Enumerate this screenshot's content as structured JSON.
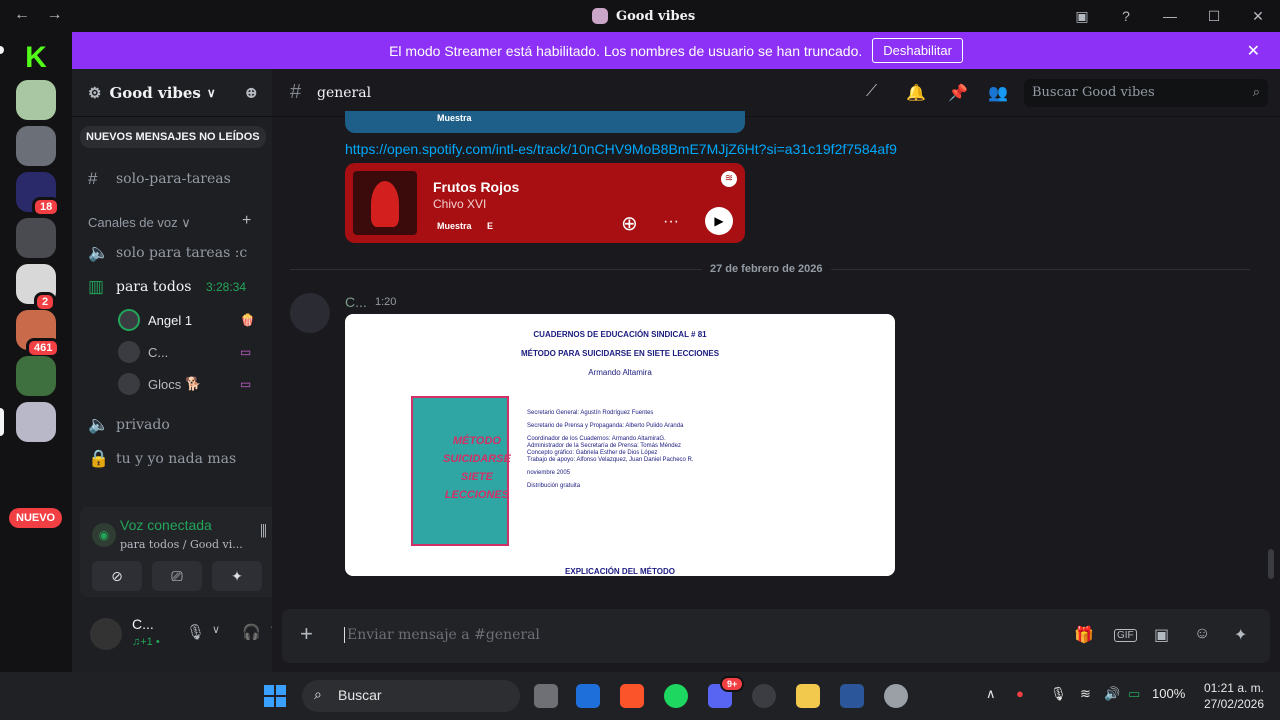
{
  "window": {
    "title": "Good vibes",
    "back": "←",
    "forward": "→"
  },
  "banner": {
    "text": "El modo Streamer está habilitado. Los nombres de usuario se han truncado.",
    "button": "Deshabilitar",
    "close": "✕"
  },
  "guilds": {
    "badges": [
      "18",
      "2",
      "461"
    ],
    "new_label": "NUEVO",
    "colors": {
      "brand_k": "#53fc18",
      "accent": "#8c31f5"
    }
  },
  "server": {
    "name": "Good vibes",
    "unread_banner": "NUEVOS MENSAJES NO LEÍDOS"
  },
  "channels": {
    "text1": "solo-para-tareas",
    "voice_header": "Canales de voz",
    "voice1": "solo para tareas :c",
    "voice2": "para todos",
    "voice2_timer": "3:28:34",
    "voice_users": [
      {
        "name": "Angel 1",
        "status": "🍿"
      },
      {
        "name": "C...",
        "status": ""
      },
      {
        "name": "Glocs",
        "status": "🐕"
      }
    ],
    "voice3": "privado",
    "voice4": "tu y yo nada mas"
  },
  "voice_panel": {
    "title": "Voz conectada",
    "sub": "para todos / Good vi..."
  },
  "user": {
    "name": "C...",
    "status": "♫+1 •"
  },
  "channel_header": {
    "name": "general",
    "search_placeholder": "Buscar Good vibes"
  },
  "messages": {
    "embed_top_tag": "Muestra",
    "link": "https://open.spotify.com/intl-es/track/10nCHV9MoB8BmE7MJjZ6Ht?si=a31c19f2f7584af9",
    "spotify": {
      "title": "Frutos Rojos",
      "artist": "Chivo XVI",
      "tag1": "Muestra",
      "tag2": "E"
    },
    "date_divider": "27 de febrero de 2026",
    "author": "C...",
    "time": "1:20",
    "doc": {
      "line1": "CUADERNOS DE EDUCACIÓN SINDICAL # 81",
      "line2": "MÉTODO PARA SUICIDARSE EN SIETE LECCIONES",
      "line3": "Armando Altamira",
      "cover_text": "MÉTODO SUICIDARSE SIETE LECCIONES",
      "credits": [
        "Secretario General: Agustín Rodríguez Fuentes",
        "Secretario de Prensa y Propaganda: Alberto Pulido Aranda",
        "Coordinador de los Cuadernos: Armando AltamiraG.",
        "Administrador de la Secretaría de Prensa: Tomás Méndez",
        "Concepto gráfico: Gabriela Esther de Dios López",
        "Trabajo de apoyo: Alfonso Velazquez, Juan Daniel Pacheco R.",
        "noviembre 2005",
        "Distribución gratuita"
      ],
      "footer": "EXPLICACIÓN DEL MÉTODO"
    }
  },
  "composer": {
    "placeholder": "Enviar mensaje a #general"
  },
  "taskbar": {
    "search": "Buscar",
    "battery": "100%",
    "time": "01:21 a. m.",
    "date": "27/02/2026",
    "discord_badge": "9+"
  }
}
